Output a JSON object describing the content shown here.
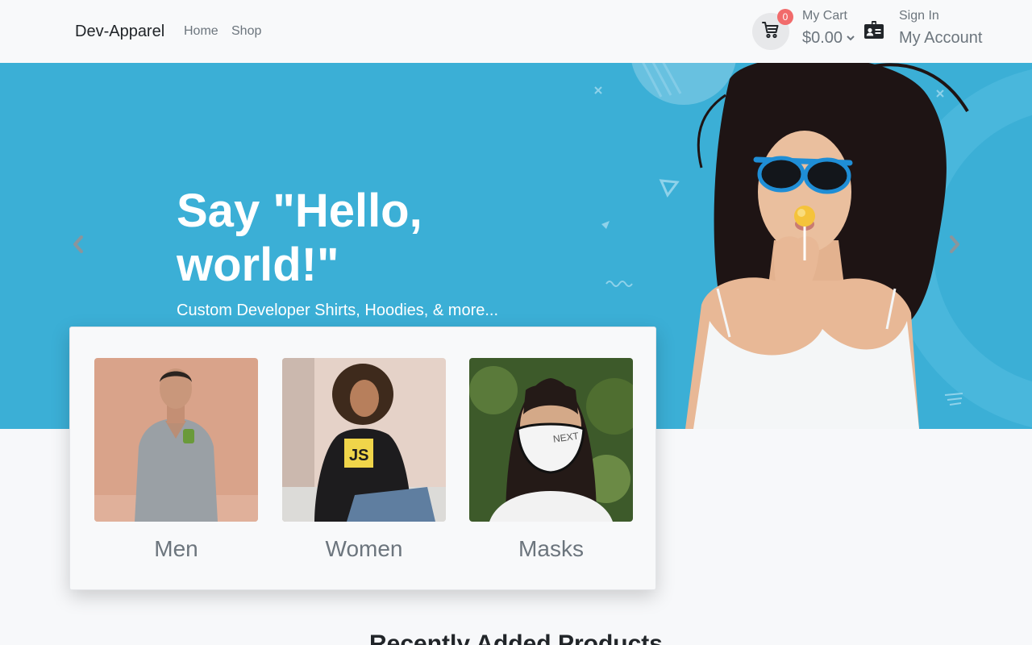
{
  "brand": "Dev-Apparel",
  "nav": {
    "home": "Home",
    "shop": "Shop"
  },
  "cart": {
    "count": "0",
    "label": "My Cart",
    "total": "$0.00"
  },
  "account": {
    "signin": "Sign In",
    "label": "My Account"
  },
  "hero": {
    "title": "Say \"Hello, world!\"",
    "subtitle": "Custom Developer Shirts, Hoodies, & more..."
  },
  "categories": [
    {
      "label": "Men"
    },
    {
      "label": "Women"
    },
    {
      "label": "Masks"
    }
  ],
  "section_title": "Recently Added Products",
  "colors": {
    "hero_bg": "#3bafd6",
    "badge": "#f16b6b",
    "muted_text": "#6c757d"
  },
  "icons": [
    "cart-icon",
    "chevron-down-icon",
    "account-card-icon",
    "chevron-left-icon",
    "chevron-right-icon"
  ]
}
